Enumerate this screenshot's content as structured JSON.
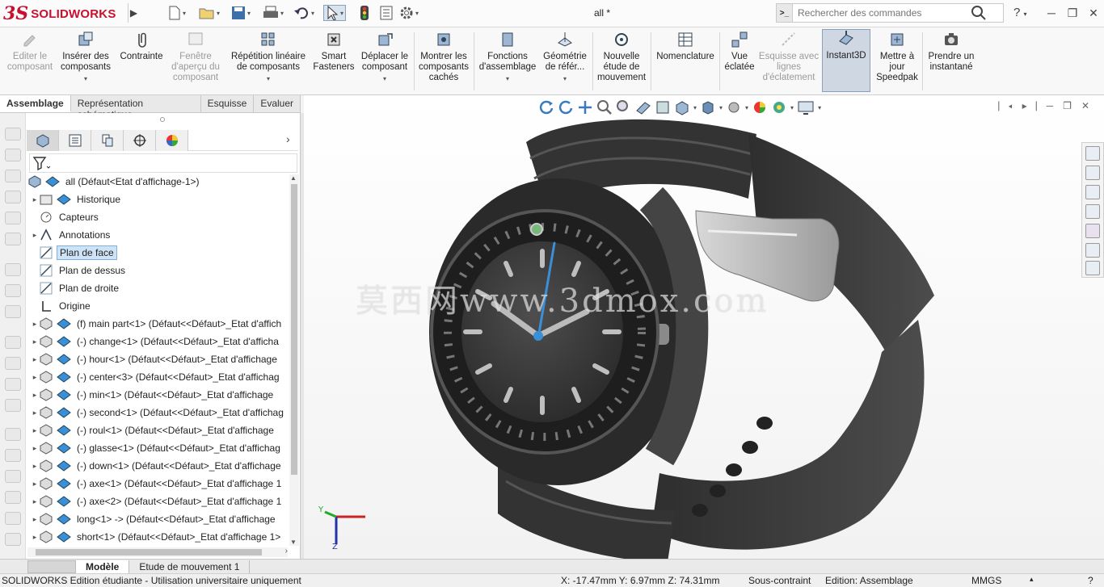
{
  "app": {
    "logo_ds": "3S",
    "logo_text": "SOLIDWORKS",
    "document_title": "all *"
  },
  "search": {
    "placeholder": "Rechercher des commandes"
  },
  "ribbon": {
    "buttons": [
      {
        "id": "edit-component",
        "label": "Editer le composant",
        "icon": "edit-component-icon",
        "disabled": true
      },
      {
        "id": "insert-components",
        "label": "Insérer des composants",
        "icon": "insert-components-icon"
      },
      {
        "id": "mate",
        "label": "Contrainte",
        "icon": "mate-paperclip-icon"
      },
      {
        "id": "preview-window",
        "label": "Fenêtre d'aperçu du composant",
        "icon": "preview-window-icon",
        "disabled": true
      },
      {
        "id": "linear-pattern",
        "label": "Répétition linéaire de composants",
        "icon": "linear-pattern-icon"
      },
      {
        "id": "smart-fasteners",
        "label": "Smart Fasteners",
        "icon": "smart-fasteners-icon"
      },
      {
        "id": "move-component",
        "label": "Déplacer le composant",
        "icon": "move-component-icon"
      },
      {
        "id": "show-hidden",
        "label": "Montrer les composants cachés",
        "icon": "show-hidden-icon"
      },
      {
        "id": "assembly-features",
        "label": "Fonctions d'assemblage",
        "icon": "assembly-features-icon"
      },
      {
        "id": "reference-geometry",
        "label": "Géométrie de référ...",
        "icon": "reference-geometry-icon"
      },
      {
        "id": "new-motion-study",
        "label": "Nouvelle étude de mouvement",
        "icon": "motion-study-icon"
      },
      {
        "id": "bom",
        "label": "Nomenclature",
        "icon": "bom-icon"
      },
      {
        "id": "exploded-view",
        "label": "Vue éclatée",
        "icon": "exploded-view-icon"
      },
      {
        "id": "explode-line-sketch",
        "label": "Esquisse avec lignes d'éclatement",
        "icon": "explode-line-icon",
        "disabled": true
      },
      {
        "id": "instant3d",
        "label": "Instant3D",
        "icon": "instant3d-icon",
        "active": true
      },
      {
        "id": "update-speedpak",
        "label": "Mettre à jour Speedpak",
        "icon": "speedpak-icon"
      },
      {
        "id": "take-snapshot",
        "label": "Prendre un instantané",
        "icon": "camera-icon"
      }
    ]
  },
  "command_tabs": [
    "Assemblage",
    "Représentation schématique",
    "Esquisse",
    "Evaluer"
  ],
  "tree": {
    "root": "all  (Défaut<Etat d'affichage-1>)",
    "items": [
      {
        "label": "Historique",
        "expand": true
      },
      {
        "label": "Capteurs",
        "expand": false
      },
      {
        "label": "Annotations",
        "expand": true
      },
      {
        "label": "Plan de face",
        "expand": false,
        "selected": true
      },
      {
        "label": "Plan de dessus",
        "expand": false
      },
      {
        "label": "Plan de droite",
        "expand": false
      },
      {
        "label": "Origine",
        "expand": false
      },
      {
        "label": "(f) main part<1> (Défaut<<Défaut>_Etat d'affich",
        "expand": true
      },
      {
        "label": "(-) change<1> (Défaut<<Défaut>_Etat d'afficha",
        "expand": true
      },
      {
        "label": "(-) hour<1> (Défaut<<Défaut>_Etat d'affichage",
        "expand": true
      },
      {
        "label": "(-) center<3> (Défaut<<Défaut>_Etat d'affichag",
        "expand": true
      },
      {
        "label": "(-) min<1> (Défaut<<Défaut>_Etat d'affichage ",
        "expand": true
      },
      {
        "label": "(-) second<1> (Défaut<<Défaut>_Etat d'affichag",
        "expand": true
      },
      {
        "label": "(-) roul<1> (Défaut<<Défaut>_Etat d'affichage ",
        "expand": true
      },
      {
        "label": "(-) glasse<1> (Défaut<<Défaut>_Etat d'affichag",
        "expand": true
      },
      {
        "label": "(-) down<1> (Défaut<<Défaut>_Etat d'affichage",
        "expand": true
      },
      {
        "label": "(-) axe<1> (Défaut<<Défaut>_Etat d'affichage 1",
        "expand": true
      },
      {
        "label": "(-) axe<2> (Défaut<<Défaut>_Etat d'affichage 1",
        "expand": true
      },
      {
        "label": "long<1> -> (Défaut<<Défaut>_Etat d'affichage",
        "expand": true
      },
      {
        "label": "short<1> (Défaut<<Défaut>_Etat d'affichage 1>",
        "expand": true
      }
    ]
  },
  "viewport": {
    "watermark": "莫西网www.3dmox.com"
  },
  "bottom_tabs": [
    "Modèle",
    "Etude de mouvement 1"
  ],
  "status": {
    "edition": "SOLIDWORKS Edition étudiante - Utilisation universitaire uniquement",
    "coords": "X: -17.47mm Y: 6.97mm Z: 74.31mm",
    "constraint": "Sous-contraint",
    "editing": "Edition: Assemblage",
    "units": "MMGS"
  },
  "colors": {
    "brand": "#c8102e",
    "selection": "#cfe3f6",
    "watch_body": "#3a3a3a",
    "second_hand": "#3a8fd6"
  }
}
